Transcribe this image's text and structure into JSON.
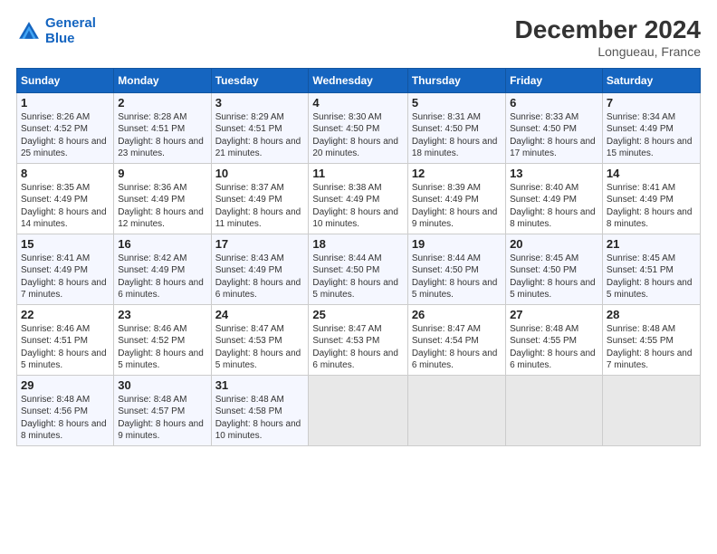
{
  "logo": {
    "line1": "General",
    "line2": "Blue"
  },
  "title": "December 2024",
  "subtitle": "Longueau, France",
  "days": [
    "Sunday",
    "Monday",
    "Tuesday",
    "Wednesday",
    "Thursday",
    "Friday",
    "Saturday"
  ],
  "weeks": [
    [
      {
        "day": "1",
        "sunrise": "8:26 AM",
        "sunset": "4:52 PM",
        "daylight": "8 hours and 25 minutes."
      },
      {
        "day": "2",
        "sunrise": "8:28 AM",
        "sunset": "4:51 PM",
        "daylight": "8 hours and 23 minutes."
      },
      {
        "day": "3",
        "sunrise": "8:29 AM",
        "sunset": "4:51 PM",
        "daylight": "8 hours and 21 minutes."
      },
      {
        "day": "4",
        "sunrise": "8:30 AM",
        "sunset": "4:50 PM",
        "daylight": "8 hours and 20 minutes."
      },
      {
        "day": "5",
        "sunrise": "8:31 AM",
        "sunset": "4:50 PM",
        "daylight": "8 hours and 18 minutes."
      },
      {
        "day": "6",
        "sunrise": "8:33 AM",
        "sunset": "4:50 PM",
        "daylight": "8 hours and 17 minutes."
      },
      {
        "day": "7",
        "sunrise": "8:34 AM",
        "sunset": "4:49 PM",
        "daylight": "8 hours and 15 minutes."
      }
    ],
    [
      {
        "day": "8",
        "sunrise": "8:35 AM",
        "sunset": "4:49 PM",
        "daylight": "8 hours and 14 minutes."
      },
      {
        "day": "9",
        "sunrise": "8:36 AM",
        "sunset": "4:49 PM",
        "daylight": "8 hours and 12 minutes."
      },
      {
        "day": "10",
        "sunrise": "8:37 AM",
        "sunset": "4:49 PM",
        "daylight": "8 hours and 11 minutes."
      },
      {
        "day": "11",
        "sunrise": "8:38 AM",
        "sunset": "4:49 PM",
        "daylight": "8 hours and 10 minutes."
      },
      {
        "day": "12",
        "sunrise": "8:39 AM",
        "sunset": "4:49 PM",
        "daylight": "8 hours and 9 minutes."
      },
      {
        "day": "13",
        "sunrise": "8:40 AM",
        "sunset": "4:49 PM",
        "daylight": "8 hours and 8 minutes."
      },
      {
        "day": "14",
        "sunrise": "8:41 AM",
        "sunset": "4:49 PM",
        "daylight": "8 hours and 8 minutes."
      }
    ],
    [
      {
        "day": "15",
        "sunrise": "8:41 AM",
        "sunset": "4:49 PM",
        "daylight": "8 hours and 7 minutes."
      },
      {
        "day": "16",
        "sunrise": "8:42 AM",
        "sunset": "4:49 PM",
        "daylight": "8 hours and 6 minutes."
      },
      {
        "day": "17",
        "sunrise": "8:43 AM",
        "sunset": "4:49 PM",
        "daylight": "8 hours and 6 minutes."
      },
      {
        "day": "18",
        "sunrise": "8:44 AM",
        "sunset": "4:50 PM",
        "daylight": "8 hours and 5 minutes."
      },
      {
        "day": "19",
        "sunrise": "8:44 AM",
        "sunset": "4:50 PM",
        "daylight": "8 hours and 5 minutes."
      },
      {
        "day": "20",
        "sunrise": "8:45 AM",
        "sunset": "4:50 PM",
        "daylight": "8 hours and 5 minutes."
      },
      {
        "day": "21",
        "sunrise": "8:45 AM",
        "sunset": "4:51 PM",
        "daylight": "8 hours and 5 minutes."
      }
    ],
    [
      {
        "day": "22",
        "sunrise": "8:46 AM",
        "sunset": "4:51 PM",
        "daylight": "8 hours and 5 minutes."
      },
      {
        "day": "23",
        "sunrise": "8:46 AM",
        "sunset": "4:52 PM",
        "daylight": "8 hours and 5 minutes."
      },
      {
        "day": "24",
        "sunrise": "8:47 AM",
        "sunset": "4:53 PM",
        "daylight": "8 hours and 5 minutes."
      },
      {
        "day": "25",
        "sunrise": "8:47 AM",
        "sunset": "4:53 PM",
        "daylight": "8 hours and 6 minutes."
      },
      {
        "day": "26",
        "sunrise": "8:47 AM",
        "sunset": "4:54 PM",
        "daylight": "8 hours and 6 minutes."
      },
      {
        "day": "27",
        "sunrise": "8:48 AM",
        "sunset": "4:55 PM",
        "daylight": "8 hours and 6 minutes."
      },
      {
        "day": "28",
        "sunrise": "8:48 AM",
        "sunset": "4:55 PM",
        "daylight": "8 hours and 7 minutes."
      }
    ],
    [
      {
        "day": "29",
        "sunrise": "8:48 AM",
        "sunset": "4:56 PM",
        "daylight": "8 hours and 8 minutes."
      },
      {
        "day": "30",
        "sunrise": "8:48 AM",
        "sunset": "4:57 PM",
        "daylight": "8 hours and 9 minutes."
      },
      {
        "day": "31",
        "sunrise": "8:48 AM",
        "sunset": "4:58 PM",
        "daylight": "8 hours and 10 minutes."
      },
      null,
      null,
      null,
      null
    ]
  ],
  "labels": {
    "sunrise": "Sunrise:",
    "sunset": "Sunset:",
    "daylight": "Daylight:"
  }
}
